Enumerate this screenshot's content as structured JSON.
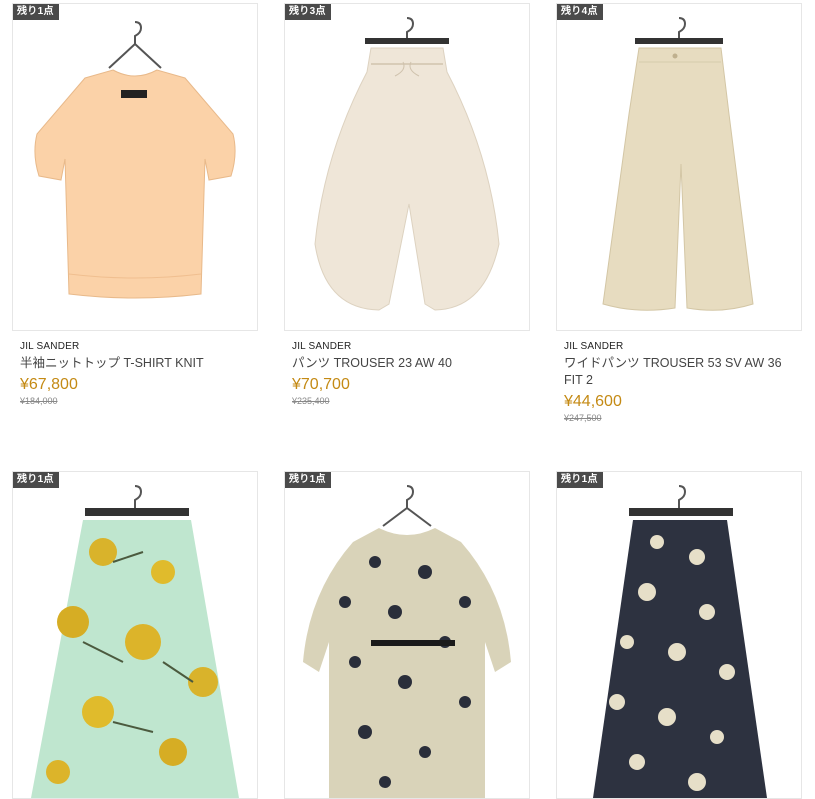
{
  "products": [
    {
      "stock": "残り1点",
      "brand": "JIL SANDER",
      "name": "半袖ニットトップ T-SHIRT KNIT",
      "price": "¥67,800",
      "original": "¥184,000"
    },
    {
      "stock": "残り3点",
      "brand": "JIL SANDER",
      "name": "パンツ TROUSER 23 AW 40",
      "price": "¥70,700",
      "original": "¥235,400"
    },
    {
      "stock": "残り4点",
      "brand": "JIL SANDER",
      "name": "ワイドパンツ TROUSER 53 SV AW 36 FIT 2",
      "price": "¥44,600",
      "original": "¥247,500"
    },
    {
      "stock": "残り1点"
    },
    {
      "stock": "残り1点"
    },
    {
      "stock": "残り1点"
    }
  ],
  "colors": {
    "price": "#c48a14",
    "badge": "#4a4a4a",
    "border": "#e6e6e6"
  }
}
